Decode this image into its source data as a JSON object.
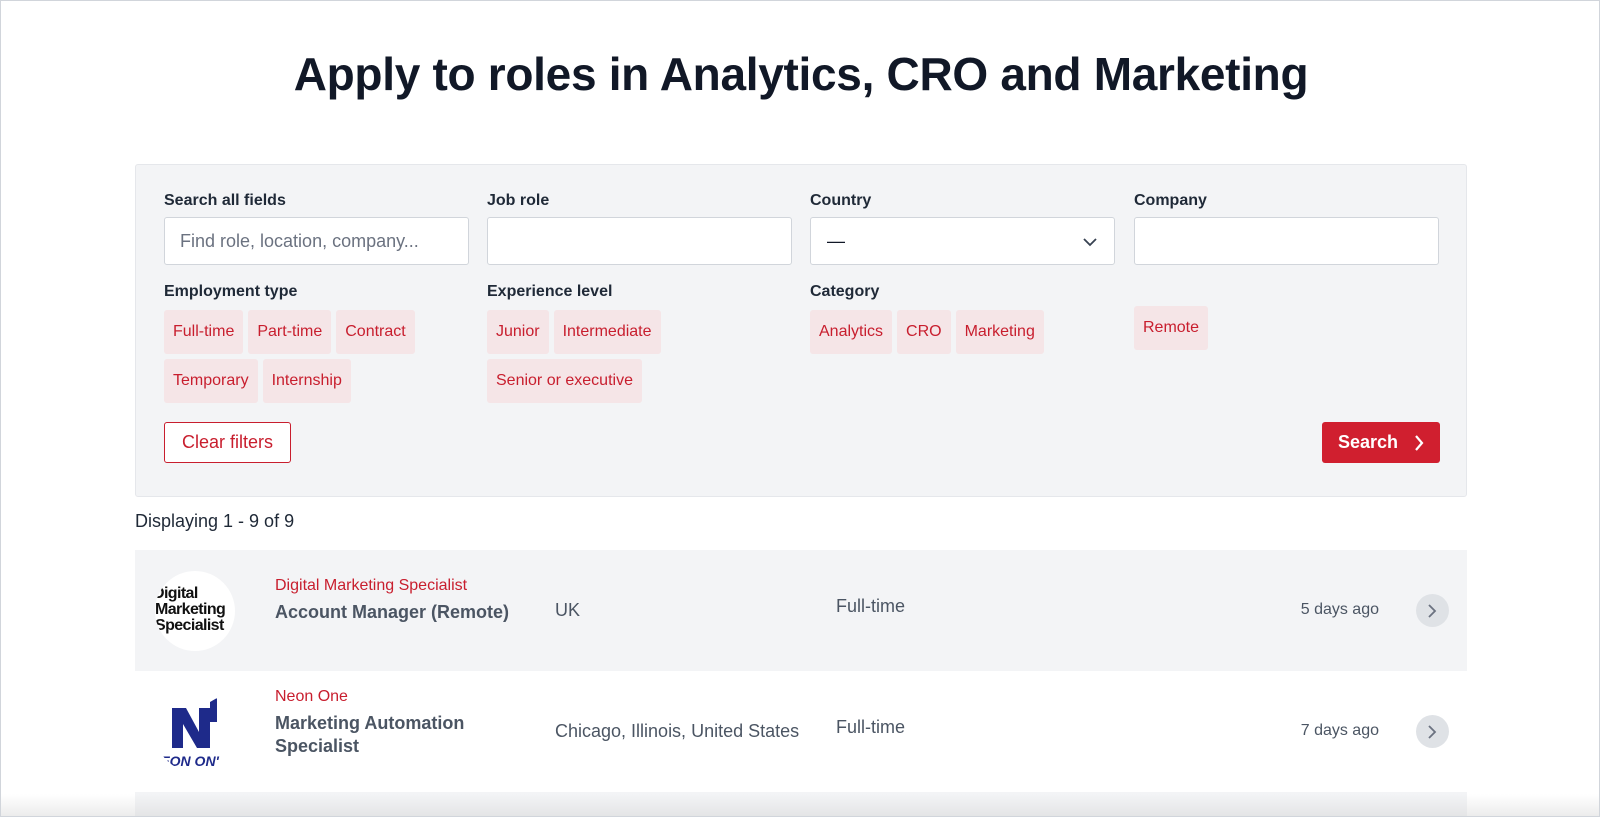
{
  "page_title": "Apply to roles in Analytics, CRO and Marketing",
  "filters": {
    "search": {
      "label": "Search all fields",
      "placeholder": "Find role, location, company..."
    },
    "job_role": {
      "label": "Job role",
      "value": ""
    },
    "country": {
      "label": "Country",
      "value": "—"
    },
    "company": {
      "label": "Company",
      "value": ""
    },
    "employment_type": {
      "label": "Employment type",
      "options": [
        "Full-time",
        "Part-time",
        "Contract",
        "Temporary",
        "Internship"
      ]
    },
    "experience_level": {
      "label": "Experience level",
      "options": [
        "Junior",
        "Intermediate",
        "Senior or executive"
      ]
    },
    "category": {
      "label": "Category",
      "options": [
        "Analytics",
        "CRO",
        "Marketing"
      ]
    },
    "remote": {
      "label": "Remote"
    },
    "clear_label": "Clear filters",
    "search_label": "Search"
  },
  "results_count": "Displaying 1 - 9 of 9",
  "jobs": [
    {
      "company": "Digital Marketing Specialist",
      "title": "Account Manager (Remote)",
      "location": "UK",
      "type": "Full-time",
      "posted": "5 days ago",
      "logo_text": "Digital Marketing Specialist"
    },
    {
      "company": "Neon One",
      "title": "Marketing Automation Specialist",
      "location": "Chicago, Illinois, United States",
      "type": "Full-time",
      "posted": "7 days ago",
      "logo_text": "NEON ONE"
    }
  ],
  "colors": {
    "accent": "#d01f2f",
    "chip_bg": "#f5e5e7",
    "panel_bg": "#f3f4f6",
    "neon_blue": "#1e2a8a"
  },
  "icons": [
    "chevron-down-icon",
    "chevron-right-icon"
  ]
}
